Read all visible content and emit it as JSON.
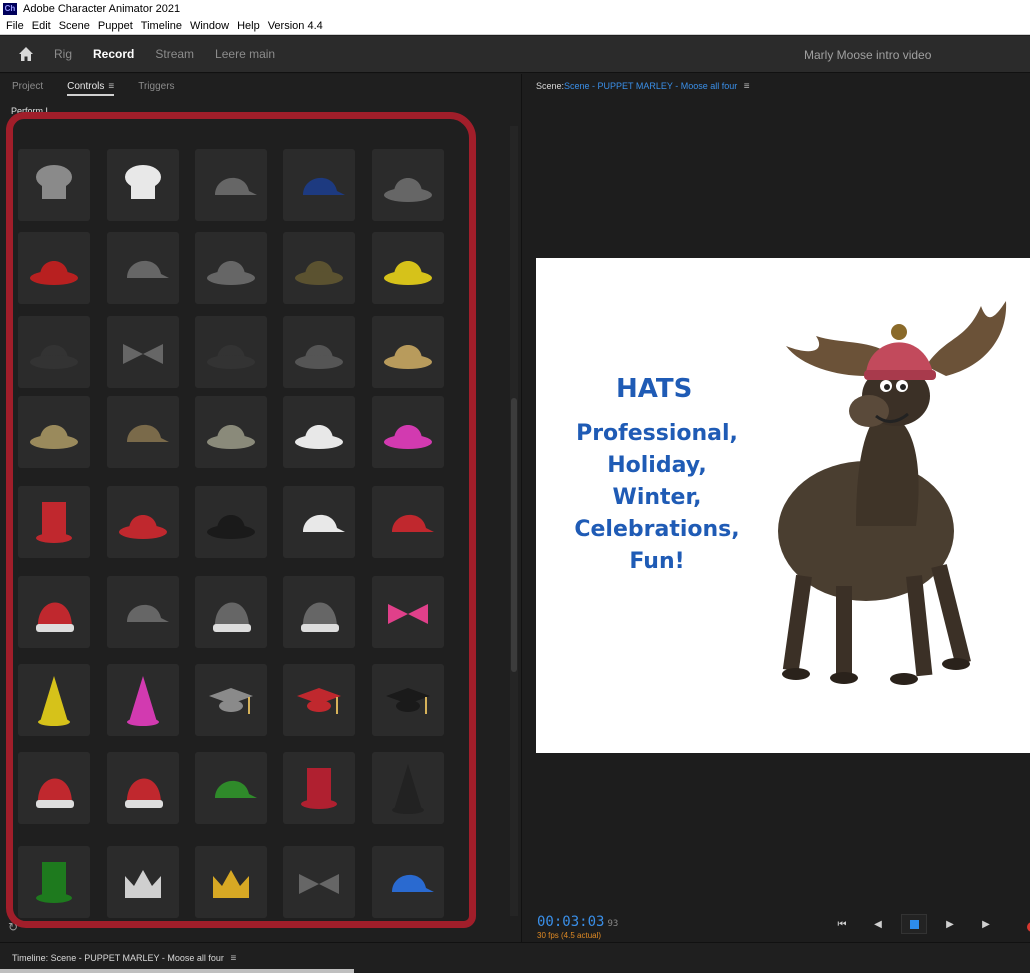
{
  "app": {
    "title": "Adobe Character Animator 2021",
    "icon_label": "Ch"
  },
  "menu": [
    "File",
    "Edit",
    "Scene",
    "Puppet",
    "Timeline",
    "Window",
    "Help",
    "Version 4.4"
  ],
  "workspace": {
    "tabs": [
      "Rig",
      "Record",
      "Stream",
      "Leere main"
    ],
    "active_tab": "Record",
    "project_name": "Marly Moose intro video"
  },
  "left_panel": {
    "tabs": [
      "Project",
      "Controls",
      "Triggers"
    ],
    "active_tab": "Controls",
    "sub_label": "Perform  L..."
  },
  "hats": [
    [
      "chef-hat-gray",
      "chef-hat-white",
      "captain-hat",
      "police-cap-blue",
      "bobby-helmet"
    ],
    [
      "fireman-helmet",
      "pilot-cap",
      "safari-hat",
      "bucket-hat-olive",
      "rain-hat-yellow"
    ],
    [
      "bush-hat-dark",
      "bowler-hat",
      "helmet-dark",
      "viking-helmet",
      "sombrero"
    ],
    [
      "cowboy-hat",
      "tweed-cap",
      "fedora-flat",
      "fedora-white",
      "bucket-hat-pink"
    ],
    [
      "fez-red",
      "beret-red",
      "beret-black",
      "baseball-cap-white",
      "baseball-cap-red"
    ],
    [
      "knit-hat-red",
      "denim-cap",
      "earflap-hat",
      "beanie-striped",
      "rainbow-beanie"
    ],
    [
      "party-hat-yellow",
      "party-hat-pink",
      "graduation-cap-gray",
      "graduation-cap-red",
      "graduation-cap-black"
    ],
    [
      "reindeer-santa-hat",
      "santa-hat",
      "green-cap",
      "uncle-sam-hat",
      "witch-hat"
    ],
    [
      "leprechaun-hat",
      "tiara",
      "crown",
      "bow-headband",
      "propeller-cap"
    ]
  ],
  "scene": {
    "header_label": "Scene:",
    "name": "Scene - PUPPET MARLEY - Moose all four",
    "title": "HATS",
    "lines": [
      "Professional,",
      "Holiday,",
      "Winter,",
      "Celebrations,",
      "Fun!"
    ]
  },
  "playback": {
    "timecode": "00:03:03",
    "frames": "93",
    "fps": "30 fps (4.5 actual)"
  },
  "timeline": {
    "title": "Timeline: Scene - PUPPET MARLEY - Moose all four"
  },
  "colors": {
    "accent": "#3a8fe8",
    "annotation": "#a11e2a",
    "stage_text": "#1f5bb5"
  }
}
